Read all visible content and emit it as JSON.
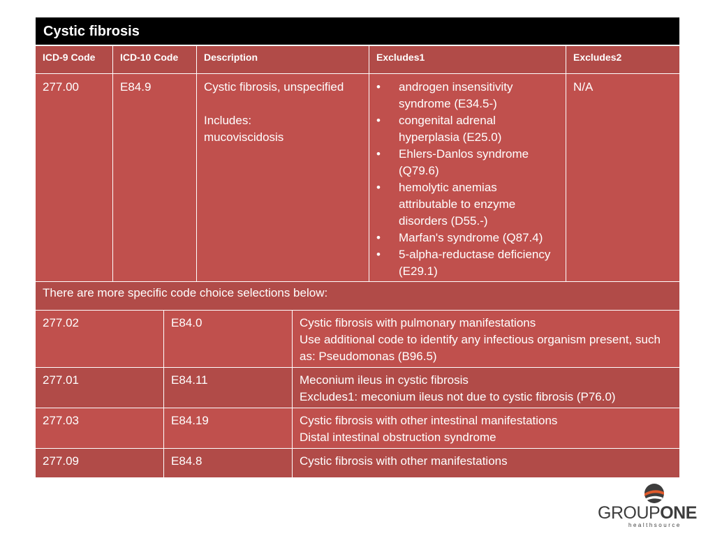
{
  "title": "Cystic fibrosis",
  "headers": [
    "ICD-9 Code",
    "ICD-10 Code",
    "Description",
    "Excludes1",
    "Excludes2"
  ],
  "main": {
    "icd9": "277.00",
    "icd10": "E84.9",
    "description": "Cystic fibrosis, unspecified",
    "includes_label": "Includes:",
    "includes_value": "mucoviscidosis",
    "excludes1": [
      "androgen insensitivity syndrome (E34.5-)",
      "congenital adrenal hyperplasia (E25.0)",
      "Ehlers-Danlos syndrome (Q79.6)",
      "hemolytic anemias attributable to enzyme disorders (D55.-)",
      "Marfan's syndrome (Q87.4)",
      "5-alpha-reductase deficiency (E29.1)"
    ],
    "excludes2": "N/A"
  },
  "note": "There are more specific code choice selections below:",
  "details": [
    {
      "icd9": "277.02",
      "icd10": "E84.0",
      "lines": [
        "Cystic fibrosis with pulmonary manifestations",
        "Use additional code to identify any infectious organism present, such as: Pseudomonas (B96.5)"
      ]
    },
    {
      "icd9": "277.01",
      "icd10": "E84.11",
      "lines": [
        "Meconium ileus in cystic fibrosis",
        "Excludes1: meconium ileus not due to cystic fibrosis (P76.0)"
      ]
    },
    {
      "icd9": "277.03",
      "icd10": "E84.19",
      "lines": [
        "Cystic fibrosis with other intestinal manifestations",
        "Distal intestinal obstruction syndrome"
      ]
    },
    {
      "icd9": "277.09",
      "icd10": "E84.8",
      "lines": [
        "Cystic fibrosis with other manifestations"
      ]
    }
  ],
  "logo": {
    "part1": "GROUP",
    "part2": "ONE",
    "sub": "healthsource"
  },
  "colors": {
    "title_bg": "#000000",
    "row_light": "#c0504d",
    "row_dark": "#b14b48",
    "logo_orange": "#e05a2b"
  }
}
